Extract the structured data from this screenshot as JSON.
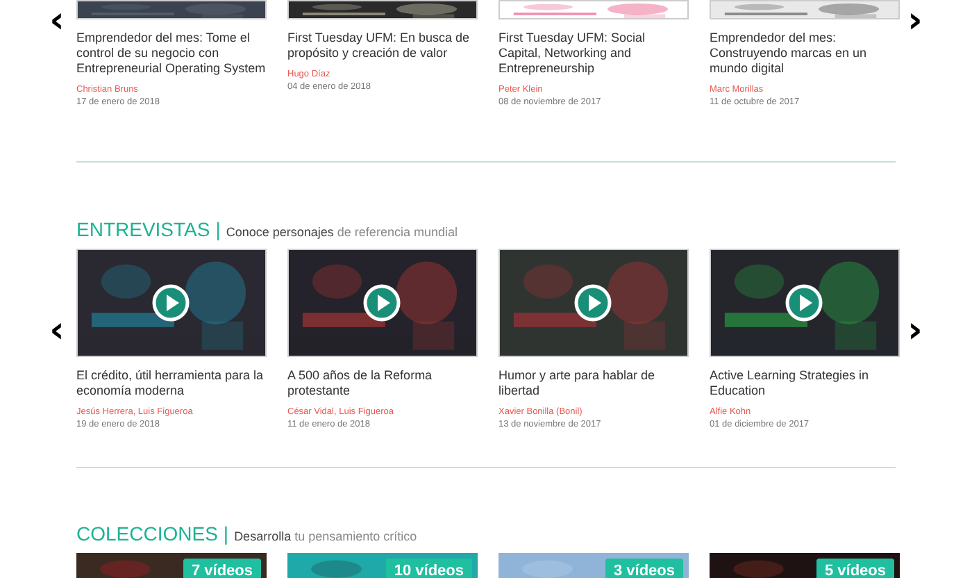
{
  "top_carousel": {
    "prev": "‹",
    "next": "›",
    "items": [
      {
        "title": "Emprendedor del mes: Tome el control de su negocio con Entrepreneurial Operating System",
        "author": "Christian Bruns",
        "date": "17 de enero de 2018"
      },
      {
        "title": "First Tuesday UFM: En busca de propósito y creación de valor",
        "author": "Hugo Díaz",
        "date": "04 de enero de 2018"
      },
      {
        "title": "First Tuesday UFM: Social Capital, Networking and Entrepreneurship",
        "author": "Peter Klein",
        "date": "08 de noviembre de 2017"
      },
      {
        "title": "Emprendedor del mes: Construyendo marcas en un mundo digital",
        "author": "Marc Morillas",
        "date": "11 de octubre de 2017"
      }
    ]
  },
  "interviews": {
    "heading": "ENTREVISTAS",
    "separator": "|",
    "subtitle_dark": "Conoce personajes",
    "subtitle_light": "de referencia mundial",
    "prev": "‹",
    "next": "›",
    "items": [
      {
        "title": "El crédito, útil herramienta para la economía moderna",
        "author": "Jesús Herrera, Luis Figueroa",
        "date": "19 de enero de 2018"
      },
      {
        "title": "A 500 años de la Reforma protestante",
        "author": "César Vidal, Luis Figueroa",
        "date": "11 de enero de 2018"
      },
      {
        "title": "Humor y arte para hablar de libertad",
        "author": "Xavier Bonilla (Bonil)",
        "date": "13 de noviembre de 2017"
      },
      {
        "title": "Active Learning Strategies in Education",
        "author": "Alfie Kohn",
        "date": "01 de diciembre de 2017"
      }
    ]
  },
  "collections": {
    "heading": "COLECCIONES",
    "separator": "|",
    "subtitle_dark": "Desarrolla",
    "subtitle_light": "tu pensamiento crítico",
    "items": [
      {
        "badge": "7 vídeos"
      },
      {
        "badge": "10 vídeos"
      },
      {
        "badge": "3 vídeos"
      },
      {
        "badge": "5 vídeos"
      }
    ]
  }
}
